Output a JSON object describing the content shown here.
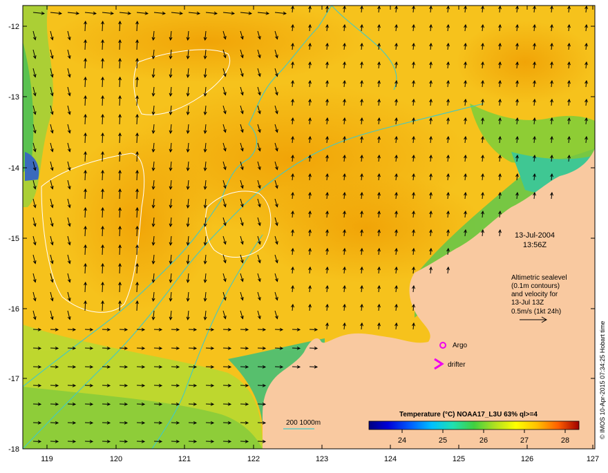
{
  "map": {
    "lon_range": [
      118.65,
      127.0
    ],
    "lat_range": [
      -18.0,
      -11.75
    ],
    "lon_ticks": [
      "119",
      "120",
      "121",
      "122",
      "123",
      "124",
      "125",
      "126",
      "127"
    ],
    "lat_ticks": [
      "-12",
      "-13",
      "-14",
      "-15",
      "-16",
      "-17",
      "-18"
    ],
    "colors": {
      "land": "#f9c9a0",
      "isobath": "#3fc9c9",
      "sealevel_contour": "#ffffff",
      "arrow": "#000000",
      "argo_marker": "#ee00ee",
      "drifter_marker": "#ee00ee"
    }
  },
  "annotations": {
    "date": "13-Jul-2004",
    "time": "13:56Z",
    "info_line1": "Altimetric sealevel",
    "info_line2": "(0.1m contours)",
    "info_line3": "and velocity for",
    "info_line4": "13-Jul 13Z",
    "info_line5": "0.5m/s (1kt 24h)",
    "argo_label": "Argo",
    "drifter_label": "drifter",
    "isobath_label": "200  1000m",
    "credit": "© IMOS 10-Apr-2015 07:34:25 Hobart time"
  },
  "colorbar": {
    "title": "Temperature (°C) NOAA17_L3U 63% ql>=4",
    "ticks": [
      "24",
      "25",
      "26",
      "27",
      "28"
    ],
    "range": [
      23.3,
      28.4
    ]
  }
}
